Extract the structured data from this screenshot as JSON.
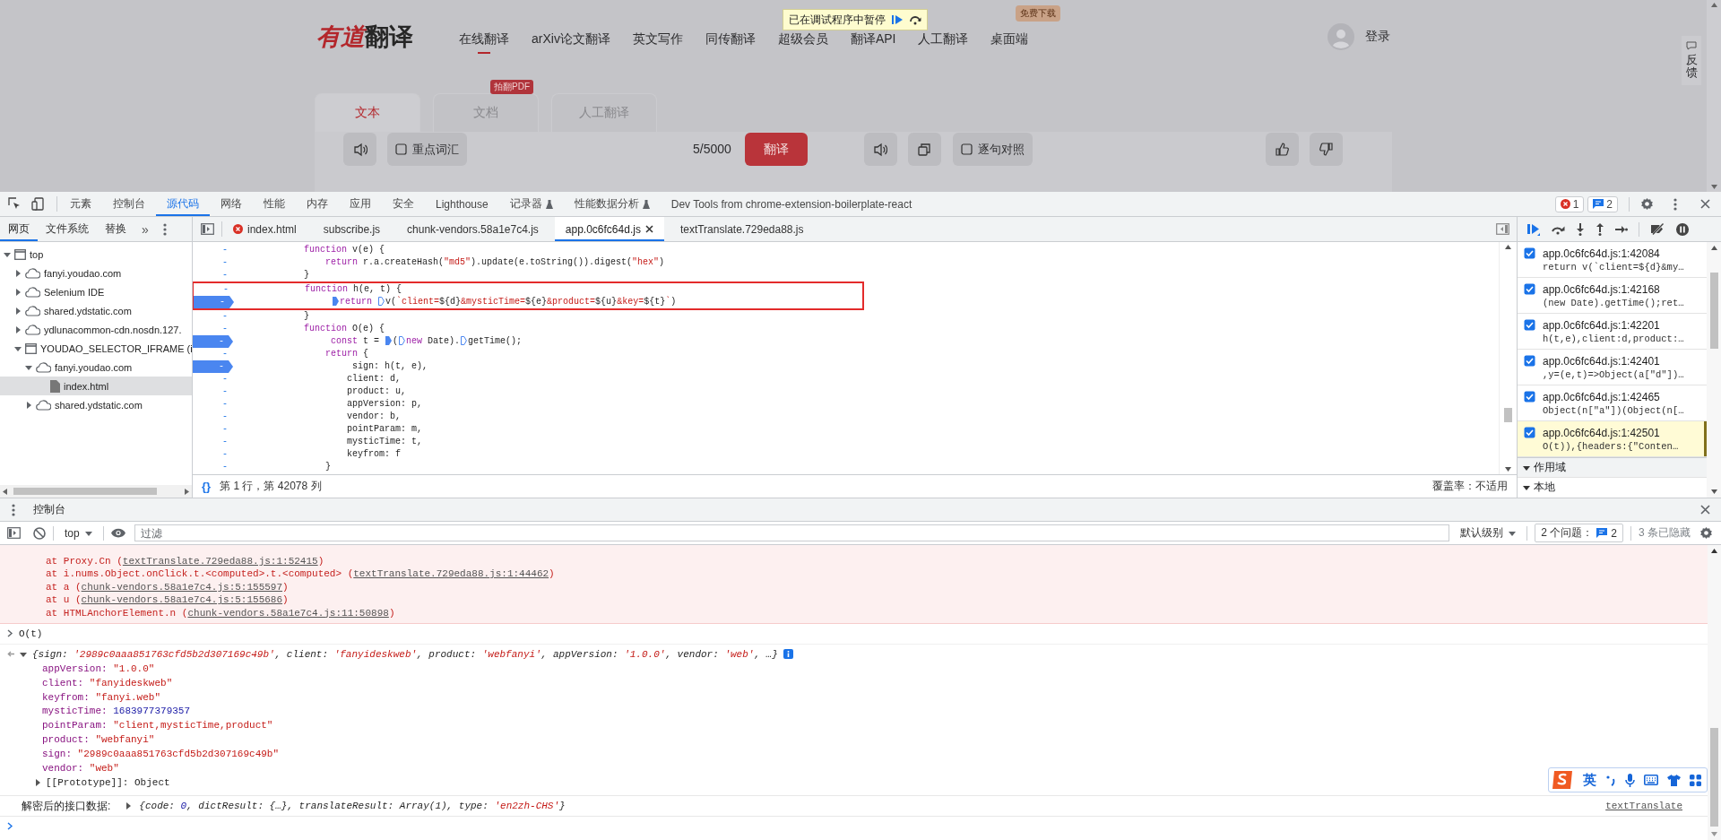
{
  "webpage": {
    "logo": {
      "brand": "有道",
      "product": "翻译"
    },
    "nav": [
      {
        "label": "在线翻译",
        "selected": true
      },
      {
        "label": "arXiv论文翻译",
        "selected": false
      },
      {
        "label": "英文写作",
        "selected": false
      },
      {
        "label": "同传翻译",
        "selected": false
      },
      {
        "label": "超级会员",
        "selected": false
      },
      {
        "label": "翻译API",
        "selected": false
      },
      {
        "label": "人工翻译",
        "selected": false
      },
      {
        "label": "桌面端",
        "selected": false,
        "badge": "免费下载"
      }
    ],
    "paused_banner": "已在调试程序中暂停",
    "login": "登录",
    "feedback": "反馈",
    "mode_tabs": [
      {
        "label": "文本",
        "selected": true
      },
      {
        "label": "文档",
        "selected": false,
        "badge": "拍翻PDF"
      },
      {
        "label": "人工翻译",
        "selected": false
      }
    ],
    "source_tools": {
      "option": {
        "label": "重点词汇",
        "checked": false
      },
      "count": "5/5000",
      "translate_button": "翻译"
    },
    "target_tools": {
      "option": {
        "label": "逐句对照",
        "checked": false
      }
    }
  },
  "devtools": {
    "tabs": [
      {
        "label": "元素",
        "selected": false,
        "experimental": false
      },
      {
        "label": "控制台",
        "selected": false,
        "experimental": false
      },
      {
        "label": "源代码",
        "selected": true,
        "experimental": false
      },
      {
        "label": "网络",
        "selected": false,
        "experimental": false
      },
      {
        "label": "性能",
        "selected": false,
        "experimental": false
      },
      {
        "label": "内存",
        "selected": false,
        "experimental": false
      },
      {
        "label": "应用",
        "selected": false,
        "experimental": false
      },
      {
        "label": "安全",
        "selected": false,
        "experimental": false
      },
      {
        "label": "Lighthouse",
        "selected": false,
        "experimental": false
      },
      {
        "label": "记录器",
        "selected": false,
        "experimental": true
      },
      {
        "label": "性能数据分析",
        "selected": false,
        "experimental": true
      },
      {
        "label": "Dev Tools from chrome-extension-boilerplate-react",
        "selected": false,
        "experimental": false
      }
    ],
    "error_count": "1",
    "message_count": "2",
    "navigator": {
      "tabs": [
        {
          "label": "网页",
          "selected": true
        },
        {
          "label": "文件系统",
          "selected": false
        },
        {
          "label": "替换",
          "selected": false
        }
      ],
      "more": "»",
      "tree": [
        {
          "label": "top",
          "kind": "frame",
          "expanded": true,
          "selected": false,
          "children": [
            {
              "label": "fanyi.youdao.com",
              "kind": "domain",
              "expanded": false,
              "selected": false
            },
            {
              "label": "Selenium IDE",
              "kind": "domain",
              "expanded": false,
              "selected": false
            },
            {
              "label": "shared.ydstatic.com",
              "kind": "domain",
              "expanded": false,
              "selected": false
            },
            {
              "label": "ydlunacommon-cdn.nosdn.127.",
              "kind": "domain",
              "expanded": false,
              "selected": false
            },
            {
              "label": "YOUDAO_SELECTOR_IFRAME (i",
              "kind": "frame",
              "expanded": true,
              "selected": false,
              "children": [
                {
                  "label": "fanyi.youdao.com",
                  "kind": "domain",
                  "expanded": true,
                  "selected": false,
                  "children": [
                    {
                      "label": "index.html",
                      "kind": "file",
                      "selected": true
                    }
                  ]
                },
                {
                  "label": "shared.ydstatic.com",
                  "kind": "domain",
                  "expanded": false,
                  "selected": false
                }
              ]
            }
          ]
        }
      ]
    },
    "editor": {
      "tabs": [
        {
          "label": "index.html",
          "selected": false,
          "error": true
        },
        {
          "label": "subscribe.js",
          "selected": false,
          "error": false
        },
        {
          "label": "chunk-vendors.58a1e7c4.js",
          "selected": false,
          "error": false
        },
        {
          "label": "app.0c6fc64d.js",
          "selected": true,
          "error": false
        },
        {
          "label": "textTranslate.729eda88.js",
          "selected": false,
          "error": false
        }
      ],
      "lines": [
        {
          "number": "-",
          "breakpoint": false,
          "code": [
            {
              "text": "function",
              "kind": "keyword"
            },
            {
              "text": " v(e) {",
              "kind": "plain"
            }
          ],
          "children": [
            {
              "number": "-",
              "breakpoint": false,
              "code": [
                {
                  "text": "return",
                  "kind": "keyword"
                },
                {
                  "text": " r.a.createHash(",
                  "kind": "plain"
                },
                {
                  "text": "\"md5\"",
                  "kind": "string"
                },
                {
                  "text": ").update(e.toString()).digest(",
                  "kind": "plain"
                },
                {
                  "text": "\"hex\"",
                  "kind": "string"
                },
                {
                  "text": ")",
                  "kind": "plain"
                }
              ]
            }
          ]
        },
        {
          "number": "-",
          "breakpoint": false,
          "code": [
            {
              "text": "}",
              "kind": "plain"
            }
          ]
        },
        {
          "number": "-",
          "breakpoint": false,
          "boxed": true,
          "code": [
            {
              "text": "function",
              "kind": "keyword"
            },
            {
              "text": " h(e, t) {",
              "kind": "plain"
            }
          ],
          "children": [
            {
              "number": "-",
              "breakpoint": true,
              "boxed": true,
              "code": [
                {
                  "kind": "marker",
                  "active": true
                },
                {
                  "text": "return ",
                  "kind": "keyword"
                },
                {
                  "kind": "marker",
                  "active": false
                },
                {
                  "text": "v(",
                  "kind": "plain"
                },
                {
                  "text": "`client=",
                  "kind": "string"
                },
                {
                  "text": "${d}",
                  "kind": "plain"
                },
                {
                  "text": "&mysticTime=",
                  "kind": "string"
                },
                {
                  "text": "${e}",
                  "kind": "plain"
                },
                {
                  "text": "&product=",
                  "kind": "string"
                },
                {
                  "text": "${u}",
                  "kind": "plain"
                },
                {
                  "text": "&key=",
                  "kind": "string"
                },
                {
                  "text": "${t}",
                  "kind": "plain"
                },
                {
                  "text": "`",
                  "kind": "string"
                },
                {
                  "text": ")",
                  "kind": "plain"
                }
              ]
            }
          ]
        },
        {
          "number": "-",
          "breakpoint": false,
          "code": [
            {
              "text": "}",
              "kind": "plain"
            }
          ]
        },
        {
          "number": "-",
          "breakpoint": false,
          "code": [
            {
              "text": "function",
              "kind": "keyword"
            },
            {
              "text": " O(e) {",
              "kind": "plain"
            }
          ],
          "children": [
            {
              "number": "-",
              "breakpoint": true,
              "code": [
                {
                  "text": "const",
                  "kind": "keyword"
                },
                {
                  "text": " t = ",
                  "kind": "plain"
                },
                {
                  "kind": "marker",
                  "active": true
                },
                {
                  "text": "(",
                  "kind": "plain"
                },
                {
                  "kind": "marker",
                  "active": false
                },
                {
                  "text": "new",
                  "kind": "keyword"
                },
                {
                  "text": " Date).",
                  "kind": "plain"
                },
                {
                  "kind": "marker",
                  "active": false
                },
                {
                  "text": "getTime();",
                  "kind": "plain"
                }
              ]
            },
            {
              "number": "-",
              "breakpoint": false,
              "code": [
                {
                  "text": "return",
                  "kind": "keyword"
                },
                {
                  "text": " {",
                  "kind": "plain"
                }
              ],
              "children": [
                {
                  "number": "-",
                  "breakpoint": true,
                  "code": [
                    {
                      "text": "sign: h(t, e),",
                      "kind": "plain"
                    }
                  ]
                },
                {
                  "number": "-",
                  "breakpoint": false,
                  "code": [
                    {
                      "text": "client: d,",
                      "kind": "plain"
                    }
                  ]
                },
                {
                  "number": "-",
                  "breakpoint": false,
                  "code": [
                    {
                      "text": "product: u,",
                      "kind": "plain"
                    }
                  ]
                },
                {
                  "number": "-",
                  "breakpoint": false,
                  "code": [
                    {
                      "text": "appVersion: p,",
                      "kind": "plain"
                    }
                  ]
                },
                {
                  "number": "-",
                  "breakpoint": false,
                  "code": [
                    {
                      "text": "vendor: b,",
                      "kind": "plain"
                    }
                  ]
                },
                {
                  "number": "-",
                  "breakpoint": false,
                  "code": [
                    {
                      "text": "pointParam: m,",
                      "kind": "plain"
                    }
                  ]
                },
                {
                  "number": "-",
                  "breakpoint": false,
                  "code": [
                    {
                      "text": "mysticTime: t,",
                      "kind": "plain"
                    }
                  ]
                },
                {
                  "number": "-",
                  "breakpoint": false,
                  "code": [
                    {
                      "text": "keyfrom: f",
                      "kind": "plain"
                    }
                  ]
                }
              ]
            },
            {
              "number": "-",
              "breakpoint": false,
              "code": [
                {
                  "text": "}",
                  "kind": "plain"
                }
              ]
            }
          ]
        }
      ],
      "pretty_print": "{}",
      "status": "第 1 行，第 42078 列",
      "coverage": "覆盖率：不适用"
    },
    "debugger": {
      "breakpoints": [
        {
          "location": "app.0c6fc64d.js:1:42084",
          "code": "return v(`client=${d}&my…",
          "checked": true,
          "selected": false
        },
        {
          "location": "app.0c6fc64d.js:1:42168",
          "code": "(new Date).getTime();ret…",
          "checked": true,
          "selected": false
        },
        {
          "location": "app.0c6fc64d.js:1:42201",
          "code": "h(t,e),client:d,product:…",
          "checked": true,
          "selected": false
        },
        {
          "location": "app.0c6fc64d.js:1:42401",
          "code": ",y=(e,t)=>Object(a[\"d\"])…",
          "checked": true,
          "selected": false
        },
        {
          "location": "app.0c6fc64d.js:1:42465",
          "code": "Object(n[\"a\"])(Object(n[…",
          "checked": true,
          "selected": false
        },
        {
          "location": "app.0c6fc64d.js:1:42501",
          "code": "O(t)),{headers:{\"Conten…",
          "checked": true,
          "selected": true
        }
      ],
      "sections": [
        {
          "label": "作用域",
          "expanded": true
        },
        {
          "label": "本地",
          "expanded": true
        }
      ]
    }
  },
  "console": {
    "tab": "控制台",
    "context": "top",
    "filter": {
      "placeholder": "过滤"
    },
    "level": "默认级别",
    "issues_label": "2 个问题：",
    "issues_count": "2",
    "hidden": "3 条已隐藏",
    "messages": [
      {
        "kind": "error",
        "frames": [
          {
            "call": "at Proxy.Cn (",
            "link": "textTranslate.729eda88.js:1:52415",
            "close": ")"
          },
          {
            "call": "at i.nums.Object.onClick.t.<computed>.t.<computed> (",
            "link": "textTranslate.729eda88.js:1:44462",
            "close": ")"
          },
          {
            "call": "at a (",
            "link": "chunk-vendors.58a1e7c4.js:5:155597",
            "close": ")"
          },
          {
            "call": "at u (",
            "link": "chunk-vendors.58a1e7c4.js:5:155686",
            "close": ")"
          },
          {
            "call": "at HTMLAnchorElement.n (",
            "link": "chunk-vendors.58a1e7c4.js:11:50898",
            "close": ")"
          }
        ]
      },
      {
        "kind": "input",
        "text": "O(t)"
      },
      {
        "kind": "result",
        "expanded": true,
        "summary": [
          {
            "text": "{sign: ",
            "kind": "plain"
          },
          {
            "text": "'2989c0aaa851763cfd5b2d307169c49b'",
            "kind": "string"
          },
          {
            "text": ", client: ",
            "kind": "plain"
          },
          {
            "text": "'fanyideskweb'",
            "kind": "string"
          },
          {
            "text": ", product: ",
            "kind": "plain"
          },
          {
            "text": "'webfanyi'",
            "kind": "string"
          },
          {
            "text": ", appVersion: ",
            "kind": "plain"
          },
          {
            "text": "'1.0.0'",
            "kind": "string"
          },
          {
            "text": ", vendor: ",
            "kind": "plain"
          },
          {
            "text": "'web'",
            "kind": "string"
          },
          {
            "text": ", …}",
            "kind": "plain"
          }
        ],
        "properties": [
          {
            "key": "appVersion:",
            "value": "\"1.0.0\"",
            "kind": "string"
          },
          {
            "key": "client:",
            "value": "\"fanyideskweb\"",
            "kind": "string"
          },
          {
            "key": "keyfrom:",
            "value": "\"fanyi.web\"",
            "kind": "string"
          },
          {
            "key": "mysticTime:",
            "value": "1683977379357",
            "kind": "number"
          },
          {
            "key": "pointParam:",
            "value": "\"client,mysticTime,product\"",
            "kind": "string"
          },
          {
            "key": "product:",
            "value": "\"webfanyi\"",
            "kind": "string"
          },
          {
            "key": "sign:",
            "value": "\"2989c0aaa851763cfd5b2d307169c49b\"",
            "kind": "string"
          },
          {
            "key": "vendor:",
            "value": "\"web\"",
            "kind": "string"
          }
        ],
        "prototype": {
          "text": "[[Prototype]]: Object",
          "expanded": false
        }
      },
      {
        "kind": "log",
        "label": "解密后的接口数据:",
        "expanded": false,
        "summary": [
          {
            "text": "{code: ",
            "kind": "plain"
          },
          {
            "text": "0",
            "kind": "number"
          },
          {
            "text": ", dictResult: {…}, translateResult: Array(1), type: ",
            "kind": "plain"
          },
          {
            "text": "'en2zh-CHS'",
            "kind": "string"
          },
          {
            "text": "}",
            "kind": "plain"
          }
        ],
        "source": "textTranslate"
      },
      {
        "kind": "prompt"
      }
    ],
    "ime": {
      "mode": "英"
    }
  }
}
